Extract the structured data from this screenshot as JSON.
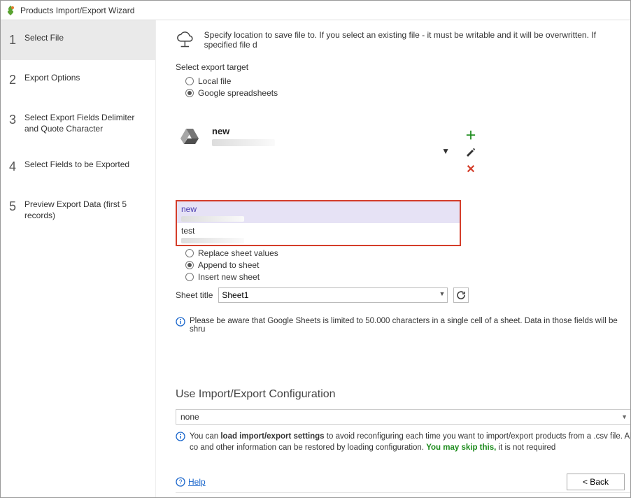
{
  "window": {
    "title": "Products Import/Export Wizard"
  },
  "sidebar": {
    "steps": [
      {
        "num": "1",
        "label": "Select File"
      },
      {
        "num": "2",
        "label": "Export Options"
      },
      {
        "num": "3",
        "label": "Select Export Fields Delimiter and Quote Character"
      },
      {
        "num": "4",
        "label": "Select Fields to be Exported"
      },
      {
        "num": "5",
        "label": "Preview Export Data (first 5 records)"
      }
    ]
  },
  "intro": "Specify location to save file to. If you select an existing file - it must be writable and it will be overwritten. If specified file d",
  "targetLabel": "Select export target",
  "targets": {
    "local": "Local file",
    "google": "Google spreadsheets"
  },
  "drive": {
    "selected": "new",
    "items": [
      {
        "title": "new"
      },
      {
        "title": "test"
      }
    ]
  },
  "sheetOptions": {
    "replace": "Replace sheet values",
    "append": "Append to sheet",
    "insert": "Insert new sheet"
  },
  "sheetTitleLabel": "Sheet title",
  "sheetTitleValue": "Sheet1",
  "warning": "Please be aware that Google Sheets is limited to 50.000 characters in a single cell of a sheet. Data in those fields will be shru",
  "configHeader": "Use Import/Export Configuration",
  "configValue": "none",
  "configInfo": {
    "pre": "You can ",
    "bold": "load import/export settings",
    "mid": " to avoid reconfiguring each time you want to import/export products from a .csv file. All co and other information can be restored by loading configuration. ",
    "green": "You may skip this,",
    "post": " it is not required"
  },
  "help": "Help",
  "backBtn": "< Back"
}
